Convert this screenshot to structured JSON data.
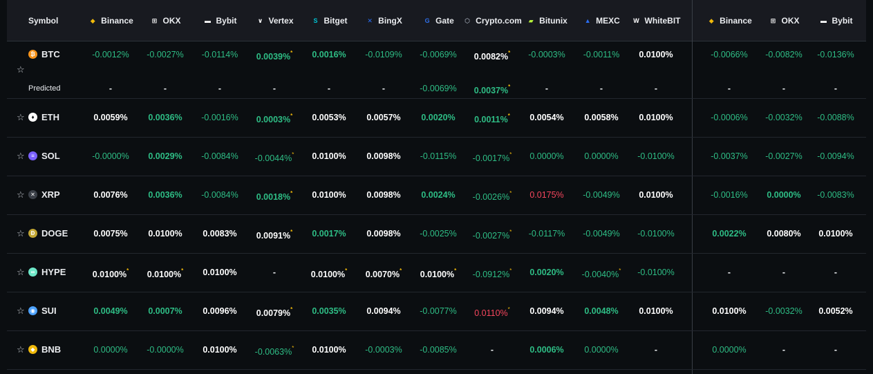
{
  "header": {
    "symbol_label": "Symbol",
    "exchanges": [
      {
        "name": "Binance",
        "icon": "binance-icon",
        "glyph": "◆",
        "color": "#f0b90b"
      },
      {
        "name": "OKX",
        "icon": "okx-icon",
        "glyph": "⊞",
        "color": "#ffffff"
      },
      {
        "name": "Bybit",
        "icon": "bybit-icon",
        "glyph": "▬",
        "color": "#ffffff"
      },
      {
        "name": "Vertex",
        "icon": "vertex-icon",
        "glyph": "∨",
        "color": "#ffffff"
      },
      {
        "name": "Bitget",
        "icon": "bitget-icon",
        "glyph": "S",
        "color": "#00c2d1"
      },
      {
        "name": "BingX",
        "icon": "bingx-icon",
        "glyph": "✕",
        "color": "#2a6ef5"
      },
      {
        "name": "Gate",
        "icon": "gate-icon",
        "glyph": "G",
        "color": "#2f6fe8"
      },
      {
        "name": "Crypto.com",
        "icon": "cryptocom-icon",
        "glyph": "⬡",
        "color": "#c3ccd9"
      },
      {
        "name": "Bitunix",
        "icon": "bitunix-icon",
        "glyph": "▰",
        "color": "#b6f23a"
      },
      {
        "name": "MEXC",
        "icon": "mexc-icon",
        "glyph": "▲",
        "color": "#2a6ef5"
      },
      {
        "name": "WhiteBIT",
        "icon": "whitebit-icon",
        "glyph": "W",
        "color": "#ffffff"
      },
      {
        "name": "Binance",
        "icon": "binance-icon",
        "glyph": "◆",
        "color": "#f0b90b"
      },
      {
        "name": "OKX",
        "icon": "okx-icon",
        "glyph": "⊞",
        "color": "#ffffff"
      },
      {
        "name": "Bybit",
        "icon": "bybit-icon",
        "glyph": "▬",
        "color": "#ffffff"
      }
    ]
  },
  "predicted_label": "Predicted",
  "rows": [
    {
      "symbol": "BTC",
      "coin_color": "#f7931a",
      "coin_glyph": "₿",
      "values": [
        {
          "v": "-0.0012%",
          "c": "pos-muted"
        },
        {
          "v": "-0.0027%",
          "c": "pos-muted"
        },
        {
          "v": "-0.0114%",
          "c": "pos-muted"
        },
        {
          "v": "0.0039%",
          "c": "pos",
          "star": true
        },
        {
          "v": "0.0016%",
          "c": "pos"
        },
        {
          "v": "-0.0109%",
          "c": "pos-muted"
        },
        {
          "v": "-0.0069%",
          "c": "pos-muted"
        },
        {
          "v": "0.0082%",
          "c": "neu",
          "star": true
        },
        {
          "v": "-0.0003%",
          "c": "pos-muted"
        },
        {
          "v": "-0.0011%",
          "c": "pos-muted"
        },
        {
          "v": "0.0100%",
          "c": "neu"
        },
        {
          "v": "-0.0066%",
          "c": "pos-muted"
        },
        {
          "v": "-0.0082%",
          "c": "pos-muted"
        },
        {
          "v": "-0.0136%",
          "c": "pos-muted"
        }
      ],
      "predicted": [
        {
          "v": "-",
          "c": "dash"
        },
        {
          "v": "-",
          "c": "dash"
        },
        {
          "v": "-",
          "c": "dash"
        },
        {
          "v": "-",
          "c": "dash"
        },
        {
          "v": "-",
          "c": "dash"
        },
        {
          "v": "-",
          "c": "dash"
        },
        {
          "v": "-0.0069%",
          "c": "pos-muted"
        },
        {
          "v": "0.0037%",
          "c": "pos",
          "star": true
        },
        {
          "v": "-",
          "c": "dash"
        },
        {
          "v": "-",
          "c": "dash"
        },
        {
          "v": "-",
          "c": "dash"
        },
        {
          "v": "-",
          "c": "dash"
        },
        {
          "v": "-",
          "c": "dash"
        },
        {
          "v": "-",
          "c": "dash"
        }
      ]
    },
    {
      "symbol": "ETH",
      "coin_color": "#ffffff",
      "coin_glyph": "♦",
      "values": [
        {
          "v": "0.0059%",
          "c": "neu"
        },
        {
          "v": "0.0036%",
          "c": "pos"
        },
        {
          "v": "-0.0016%",
          "c": "pos-muted"
        },
        {
          "v": "0.0003%",
          "c": "pos",
          "star": true
        },
        {
          "v": "0.0053%",
          "c": "neu"
        },
        {
          "v": "0.0057%",
          "c": "neu"
        },
        {
          "v": "0.0020%",
          "c": "pos"
        },
        {
          "v": "0.0011%",
          "c": "pos",
          "star": true
        },
        {
          "v": "0.0054%",
          "c": "neu"
        },
        {
          "v": "0.0058%",
          "c": "neu"
        },
        {
          "v": "0.0100%",
          "c": "neu"
        },
        {
          "v": "-0.0006%",
          "c": "pos-muted"
        },
        {
          "v": "-0.0032%",
          "c": "pos-muted"
        },
        {
          "v": "-0.0088%",
          "c": "pos-muted"
        }
      ]
    },
    {
      "symbol": "SOL",
      "coin_color": "#7b61ff",
      "coin_glyph": "≡",
      "values": [
        {
          "v": "-0.0000%",
          "c": "pos-muted"
        },
        {
          "v": "0.0029%",
          "c": "pos"
        },
        {
          "v": "-0.0084%",
          "c": "pos-muted"
        },
        {
          "v": "-0.0044%",
          "c": "pos-muted",
          "star": true
        },
        {
          "v": "0.0100%",
          "c": "neu"
        },
        {
          "v": "0.0098%",
          "c": "neu"
        },
        {
          "v": "-0.0115%",
          "c": "pos-muted"
        },
        {
          "v": "-0.0017%",
          "c": "pos-muted",
          "star": true
        },
        {
          "v": "0.0000%",
          "c": "pos-muted"
        },
        {
          "v": "0.0000%",
          "c": "pos-muted"
        },
        {
          "v": "-0.0100%",
          "c": "pos-muted"
        },
        {
          "v": "-0.0037%",
          "c": "pos-muted"
        },
        {
          "v": "-0.0027%",
          "c": "pos-muted"
        },
        {
          "v": "-0.0094%",
          "c": "pos-muted"
        }
      ]
    },
    {
      "symbol": "XRP",
      "coin_color": "#3a3f47",
      "coin_glyph": "✕",
      "values": [
        {
          "v": "0.0076%",
          "c": "neu"
        },
        {
          "v": "0.0036%",
          "c": "pos"
        },
        {
          "v": "-0.0084%",
          "c": "pos-muted"
        },
        {
          "v": "0.0018%",
          "c": "pos",
          "star": true
        },
        {
          "v": "0.0100%",
          "c": "neu"
        },
        {
          "v": "0.0098%",
          "c": "neu"
        },
        {
          "v": "0.0024%",
          "c": "pos"
        },
        {
          "v": "-0.0026%",
          "c": "pos-muted",
          "star": true
        },
        {
          "v": "0.0175%",
          "c": "neg"
        },
        {
          "v": "-0.0049%",
          "c": "pos-muted"
        },
        {
          "v": "0.0100%",
          "c": "neu"
        },
        {
          "v": "-0.0016%",
          "c": "pos-muted"
        },
        {
          "v": "0.0000%",
          "c": "pos"
        },
        {
          "v": "-0.0083%",
          "c": "pos-muted"
        }
      ]
    },
    {
      "symbol": "DOGE",
      "coin_color": "#c2a633",
      "coin_glyph": "Ð",
      "values": [
        {
          "v": "0.0075%",
          "c": "neu"
        },
        {
          "v": "0.0100%",
          "c": "neu"
        },
        {
          "v": "0.0083%",
          "c": "neu"
        },
        {
          "v": "0.0091%",
          "c": "neu",
          "star": true
        },
        {
          "v": "0.0017%",
          "c": "pos"
        },
        {
          "v": "0.0098%",
          "c": "neu"
        },
        {
          "v": "-0.0025%",
          "c": "pos-muted"
        },
        {
          "v": "-0.0027%",
          "c": "pos-muted",
          "star": true
        },
        {
          "v": "-0.0117%",
          "c": "pos-muted"
        },
        {
          "v": "-0.0049%",
          "c": "pos-muted"
        },
        {
          "v": "-0.0100%",
          "c": "pos-muted"
        },
        {
          "v": "0.0022%",
          "c": "pos"
        },
        {
          "v": "0.0080%",
          "c": "neu"
        },
        {
          "v": "0.0100%",
          "c": "neu"
        }
      ]
    },
    {
      "symbol": "HYPE",
      "coin_color": "#6ee7c8",
      "coin_glyph": "∞",
      "values": [
        {
          "v": "0.0100%",
          "c": "neu",
          "star": true
        },
        {
          "v": "0.0100%",
          "c": "neu",
          "star": true
        },
        {
          "v": "0.0100%",
          "c": "neu"
        },
        {
          "v": "-",
          "c": "dash"
        },
        {
          "v": "0.0100%",
          "c": "neu",
          "star": true
        },
        {
          "v": "0.0070%",
          "c": "neu",
          "star": true
        },
        {
          "v": "0.0100%",
          "c": "neu",
          "star": true
        },
        {
          "v": "-0.0912%",
          "c": "pos-muted",
          "star": true
        },
        {
          "v": "0.0020%",
          "c": "pos"
        },
        {
          "v": "-0.0040%",
          "c": "pos-muted",
          "star": true
        },
        {
          "v": "-0.0100%",
          "c": "pos-muted"
        },
        {
          "v": "-",
          "c": "dash"
        },
        {
          "v": "-",
          "c": "dash"
        },
        {
          "v": "-",
          "c": "dash"
        }
      ]
    },
    {
      "symbol": "SUI",
      "coin_color": "#4da2ff",
      "coin_glyph": "◉",
      "values": [
        {
          "v": "0.0049%",
          "c": "pos"
        },
        {
          "v": "0.0007%",
          "c": "pos"
        },
        {
          "v": "0.0096%",
          "c": "neu"
        },
        {
          "v": "0.0079%",
          "c": "neu",
          "star": true
        },
        {
          "v": "0.0035%",
          "c": "pos"
        },
        {
          "v": "0.0094%",
          "c": "neu"
        },
        {
          "v": "-0.0077%",
          "c": "pos-muted"
        },
        {
          "v": "0.0110%",
          "c": "neg",
          "star": true
        },
        {
          "v": "0.0094%",
          "c": "neu"
        },
        {
          "v": "0.0048%",
          "c": "pos"
        },
        {
          "v": "0.0100%",
          "c": "neu"
        },
        {
          "v": "0.0100%",
          "c": "neu"
        },
        {
          "v": "-0.0032%",
          "c": "pos-muted"
        },
        {
          "v": "0.0052%",
          "c": "neu"
        }
      ]
    },
    {
      "symbol": "BNB",
      "coin_color": "#f0b90b",
      "coin_glyph": "◆",
      "values": [
        {
          "v": "0.0000%",
          "c": "pos-muted"
        },
        {
          "v": "-0.0000%",
          "c": "pos-muted"
        },
        {
          "v": "0.0100%",
          "c": "neu"
        },
        {
          "v": "-0.0063%",
          "c": "pos-muted",
          "star": true
        },
        {
          "v": "0.0100%",
          "c": "neu"
        },
        {
          "v": "-0.0003%",
          "c": "pos-muted"
        },
        {
          "v": "-0.0085%",
          "c": "pos-muted"
        },
        {
          "v": "-",
          "c": "dash"
        },
        {
          "v": "0.0006%",
          "c": "pos"
        },
        {
          "v": "0.0000%",
          "c": "pos-muted"
        },
        {
          "v": "-",
          "c": "dash"
        },
        {
          "v": "0.0000%",
          "c": "pos-muted"
        },
        {
          "v": "-",
          "c": "dash"
        },
        {
          "v": "-",
          "c": "dash"
        }
      ]
    }
  ]
}
